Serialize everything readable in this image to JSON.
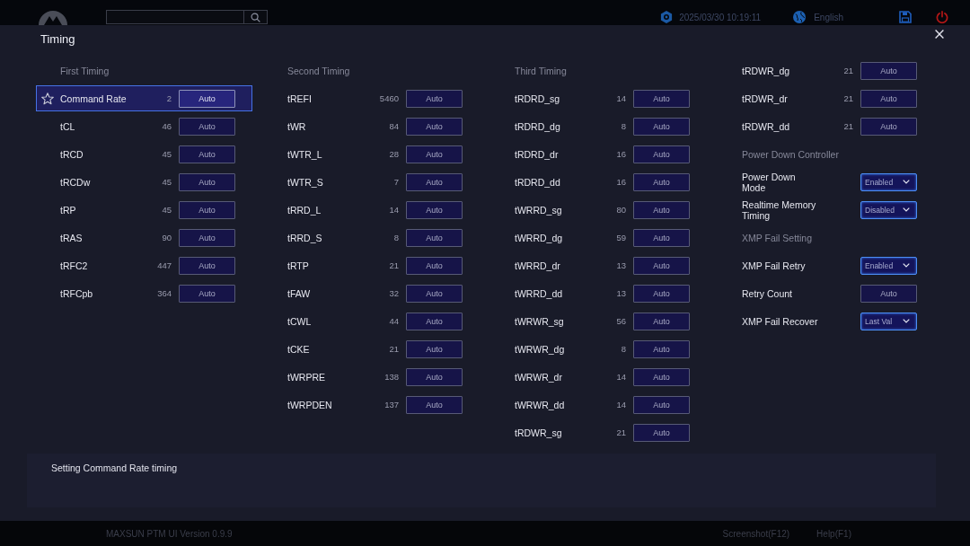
{
  "top_bar": {
    "datetime": "2025/03/30 10:19:11",
    "language": "English"
  },
  "dialog": {
    "title": "Timing",
    "columns": [
      {
        "groups": [
          {
            "title": "First Timing",
            "rows": [
              {
                "label": "Command Rate",
                "value": "2",
                "kind": "auto",
                "control": "Auto",
                "selected": true
              },
              {
                "label": "tCL",
                "value": "46",
                "kind": "auto",
                "control": "Auto",
                "selected": false
              },
              {
                "label": "tRCD",
                "value": "45",
                "kind": "auto",
                "control": "Auto",
                "selected": false
              },
              {
                "label": "tRCDw",
                "value": "45",
                "kind": "auto",
                "control": "Auto",
                "selected": false
              },
              {
                "label": "tRP",
                "value": "45",
                "kind": "auto",
                "control": "Auto",
                "selected": false
              },
              {
                "label": "tRAS",
                "value": "90",
                "kind": "auto",
                "control": "Auto",
                "selected": false
              },
              {
                "label": "tRFC2",
                "value": "447",
                "kind": "auto",
                "control": "Auto",
                "selected": false
              },
              {
                "label": "tRFCpb",
                "value": "364",
                "kind": "auto",
                "control": "Auto",
                "selected": false
              }
            ]
          }
        ]
      },
      {
        "groups": [
          {
            "title": "Second Timing",
            "rows": [
              {
                "label": "tREFI",
                "value": "5460",
                "kind": "auto",
                "control": "Auto",
                "selected": false
              },
              {
                "label": "tWR",
                "value": "84",
                "kind": "auto",
                "control": "Auto",
                "selected": false
              },
              {
                "label": "tWTR_L",
                "value": "28",
                "kind": "auto",
                "control": "Auto",
                "selected": false
              },
              {
                "label": "tWTR_S",
                "value": "7",
                "kind": "auto",
                "control": "Auto",
                "selected": false
              },
              {
                "label": "tRRD_L",
                "value": "14",
                "kind": "auto",
                "control": "Auto",
                "selected": false
              },
              {
                "label": "tRRD_S",
                "value": "8",
                "kind": "auto",
                "control": "Auto",
                "selected": false
              },
              {
                "label": "tRTP",
                "value": "21",
                "kind": "auto",
                "control": "Auto",
                "selected": false
              },
              {
                "label": "tFAW",
                "value": "32",
                "kind": "auto",
                "control": "Auto",
                "selected": false
              },
              {
                "label": "tCWL",
                "value": "44",
                "kind": "auto",
                "control": "Auto",
                "selected": false
              },
              {
                "label": "tCKE",
                "value": "21",
                "kind": "auto",
                "control": "Auto",
                "selected": false
              },
              {
                "label": "tWRPRE",
                "value": "138",
                "kind": "auto",
                "control": "Auto",
                "selected": false
              },
              {
                "label": "tWRPDEN",
                "value": "137",
                "kind": "auto",
                "control": "Auto",
                "selected": false
              }
            ]
          }
        ]
      },
      {
        "groups": [
          {
            "title": "Third Timing",
            "rows": [
              {
                "label": "tRDRD_sg",
                "value": "14",
                "kind": "auto",
                "control": "Auto",
                "selected": false
              },
              {
                "label": "tRDRD_dg",
                "value": "8",
                "kind": "auto",
                "control": "Auto",
                "selected": false
              },
              {
                "label": "tRDRD_dr",
                "value": "16",
                "kind": "auto",
                "control": "Auto",
                "selected": false
              },
              {
                "label": "tRDRD_dd",
                "value": "16",
                "kind": "auto",
                "control": "Auto",
                "selected": false
              },
              {
                "label": "tWRRD_sg",
                "value": "80",
                "kind": "auto",
                "control": "Auto",
                "selected": false
              },
              {
                "label": "tWRRD_dg",
                "value": "59",
                "kind": "auto",
                "control": "Auto",
                "selected": false
              },
              {
                "label": "tWRRD_dr",
                "value": "13",
                "kind": "auto",
                "control": "Auto",
                "selected": false
              },
              {
                "label": "tWRRD_dd",
                "value": "13",
                "kind": "auto",
                "control": "Auto",
                "selected": false
              },
              {
                "label": "tWRWR_sg",
                "value": "56",
                "kind": "auto",
                "control": "Auto",
                "selected": false
              },
              {
                "label": "tWRWR_dg",
                "value": "8",
                "kind": "auto",
                "control": "Auto",
                "selected": false
              },
              {
                "label": "tWRWR_dr",
                "value": "14",
                "kind": "auto",
                "control": "Auto",
                "selected": false
              },
              {
                "label": "tWRWR_dd",
                "value": "14",
                "kind": "auto",
                "control": "Auto",
                "selected": false
              },
              {
                "label": "tRDWR_sg",
                "value": "21",
                "kind": "auto",
                "control": "Auto",
                "selected": false
              }
            ]
          }
        ]
      },
      {
        "groups": [
          {
            "rows": [
              {
                "label": "tRDWR_dg",
                "value": "21",
                "kind": "auto",
                "control": "Auto",
                "selected": false
              },
              {
                "label": "tRDWR_dr",
                "value": "21",
                "kind": "auto",
                "control": "Auto",
                "selected": false
              },
              {
                "label": "tRDWR_dd",
                "value": "21",
                "kind": "auto",
                "control": "Auto",
                "selected": false
              }
            ]
          },
          {
            "title": "Power Down Controller",
            "rows": [
              {
                "label": "Power Down Mode",
                "kind": "dropdown",
                "control": "Enabled",
                "selected": false
              },
              {
                "label": "Realtime Memory Timing",
                "kind": "dropdown",
                "control": "Disabled",
                "selected": false
              }
            ]
          },
          {
            "title": "XMP Fail Setting",
            "rows": [
              {
                "label": "XMP Fail Retry",
                "kind": "dropdown",
                "control": "Enabled",
                "selected": false
              },
              {
                "label": "Retry Count",
                "kind": "auto",
                "control": "Auto",
                "selected": false
              },
              {
                "label": "XMP Fail Recover",
                "kind": "dropdown",
                "control": "Last Val",
                "selected": false
              }
            ]
          }
        ]
      }
    ]
  },
  "help": {
    "text": "Setting Command Rate timing"
  },
  "footer": {
    "version": "MAXSUN PTM UI Version 0.9.9",
    "hotkeys": [
      "Screenshot(F12)",
      "Help(F1)"
    ]
  }
}
